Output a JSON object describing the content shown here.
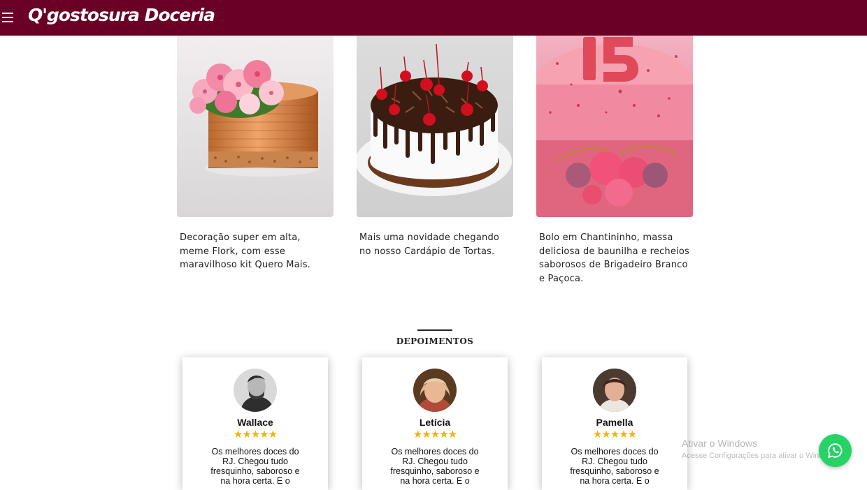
{
  "header": {
    "menu_icon": "hamburger-menu-icon",
    "brand": "Q'gostosura Doceria",
    "background_color": "#6a0026"
  },
  "products": [
    {
      "image": "orange-cake-with-pink-flowers",
      "caption": "Decoração super em alta, meme Flork, com esse maravilhoso kit Quero Mais."
    },
    {
      "image": "chocolate-drip-cake-with-cherries",
      "caption": "Mais uma novidade chegando no nosso Cardápio de Tortas."
    },
    {
      "image": "pink-cake-with-number-15",
      "caption": "Bolo em Chantininho, massa deliciosa de baunilha e recheios saborosos de Brigadeiro Branco e Paçoca."
    }
  ],
  "testimonials_section": {
    "title": "DEPOIMENTOS",
    "items": [
      {
        "name": "Wallace",
        "rating": 5,
        "stars": "★★★★★",
        "text": "Os melhores doces do RJ. Chegou tudo fresquinho, saboroso e na hora certa. E o"
      },
      {
        "name": "Letícia",
        "rating": 5,
        "stars": "★★★★★",
        "text": "Os melhores doces do RJ. Chegou tudo fresquinho, saboroso e na hora certa. E o"
      },
      {
        "name": "Pamella",
        "rating": 5,
        "stars": "★★★★★",
        "text": "Os melhores doces do RJ. Chegou tudo fresquinho, saboroso e na hora certa. E o"
      }
    ]
  },
  "os_watermark": {
    "line1": "Ativar o Windows",
    "line2": "Acesse Configurações para ativar o Windows."
  },
  "whatsapp": {
    "icon": "whatsapp-icon",
    "color": "#25d366"
  }
}
